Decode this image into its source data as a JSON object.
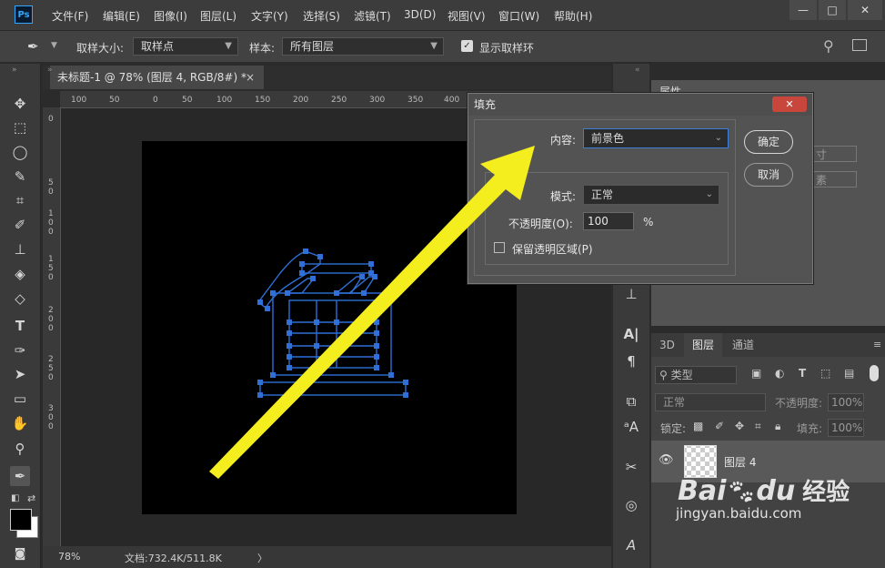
{
  "app": {
    "logo": "Ps"
  },
  "menu": [
    "文件(F)",
    "编辑(E)",
    "图像(I)",
    "图层(L)",
    "文字(Y)",
    "选择(S)",
    "滤镜(T)",
    "3D(D)",
    "视图(V)",
    "窗口(W)",
    "帮助(H)"
  ],
  "window_controls": {
    "minimize": "—",
    "restore": "□",
    "close": "✕"
  },
  "options": {
    "sample_size_label": "取样大小:",
    "sample_size_value": "取样点",
    "sample_label": "样本:",
    "sample_value": "所有图层",
    "show_ring_label": "显示取样环",
    "show_ring_checked": true
  },
  "document": {
    "tab_title": "未标题-1 @ 78% (图层 4, RGB/8#) *",
    "close": "×",
    "ruler_h": [
      "100",
      "50",
      "0",
      "50",
      "100",
      "150",
      "200",
      "250",
      "300",
      "350",
      "400"
    ],
    "ruler_v": [
      "0",
      "5",
      "0",
      "1",
      "0",
      "0",
      "1",
      "5",
      "0",
      "2",
      "0",
      "0",
      "2",
      "5",
      "0",
      "3",
      "0",
      "0"
    ]
  },
  "status": {
    "zoom": "78%",
    "doc_info": "文档:732.4K/511.8K",
    "arrow": "〉"
  },
  "properties_panel": {
    "tab": "属性",
    "field1": "寸",
    "field2": "素"
  },
  "layers_panel": {
    "tabs": [
      "3D",
      "图层",
      "通道"
    ],
    "filter_label": "类型",
    "blend_mode": "正常",
    "opacity_label": "不透明度:",
    "opacity_value": "100%",
    "lock_label": "锁定:",
    "fill_label": "填充:",
    "fill_value": "100%",
    "layer_name": "图层 4"
  },
  "fill_dialog": {
    "title": "填充",
    "close": "✕",
    "content_label": "内容:",
    "content_value": "前景色",
    "mode_label": "模式:",
    "mode_value": "正常",
    "opacity_label": "不透明度(O):",
    "opacity_value": "100",
    "opacity_unit": "%",
    "preserve_label": "保留透明区域(P)",
    "preserve_checked": false,
    "ok_label": "确定",
    "cancel_label": "取消"
  },
  "watermark": {
    "brand": "Bai",
    "brand2": "du",
    "cn": "经验",
    "url": "jingyan.baidu.com"
  },
  "colors": {
    "accent": "#31a8ff",
    "path_blue": "#2f6fd6",
    "arrow_yellow": "#f4ee1e"
  }
}
